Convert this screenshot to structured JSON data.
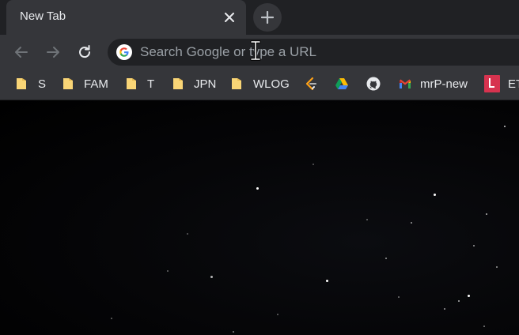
{
  "tab": {
    "title": "New Tab",
    "close_icon": "close-icon"
  },
  "new_tab_icon": "plus-icon",
  "toolbar": {
    "back_icon": "arrow-left-icon",
    "forward_icon": "arrow-right-icon",
    "reload_icon": "reload-icon",
    "omnibox": {
      "value": "",
      "placeholder": "Search Google or type a URL",
      "icon": "google-icon"
    }
  },
  "bookmarks": [
    {
      "label": "S",
      "icon": "folder-icon"
    },
    {
      "label": "FAM",
      "icon": "folder-icon"
    },
    {
      "label": "T",
      "icon": "folder-icon"
    },
    {
      "label": "JPN",
      "icon": "folder-icon"
    },
    {
      "label": "WLOG",
      "icon": "folder-icon"
    },
    {
      "label": "",
      "icon": "leetcode-icon"
    },
    {
      "label": "",
      "icon": "google-drive-icon"
    },
    {
      "label": "",
      "icon": "github-icon"
    },
    {
      "label": "mrP-new",
      "icon": "gmail-icon"
    },
    {
      "label": "ET",
      "icon": "red-l-icon"
    }
  ],
  "colors": {
    "tab_strip": "#202124",
    "toolbar": "#35363a",
    "omnibox": "#202124",
    "text": "#e8eaed",
    "folder": "#f9d576"
  }
}
